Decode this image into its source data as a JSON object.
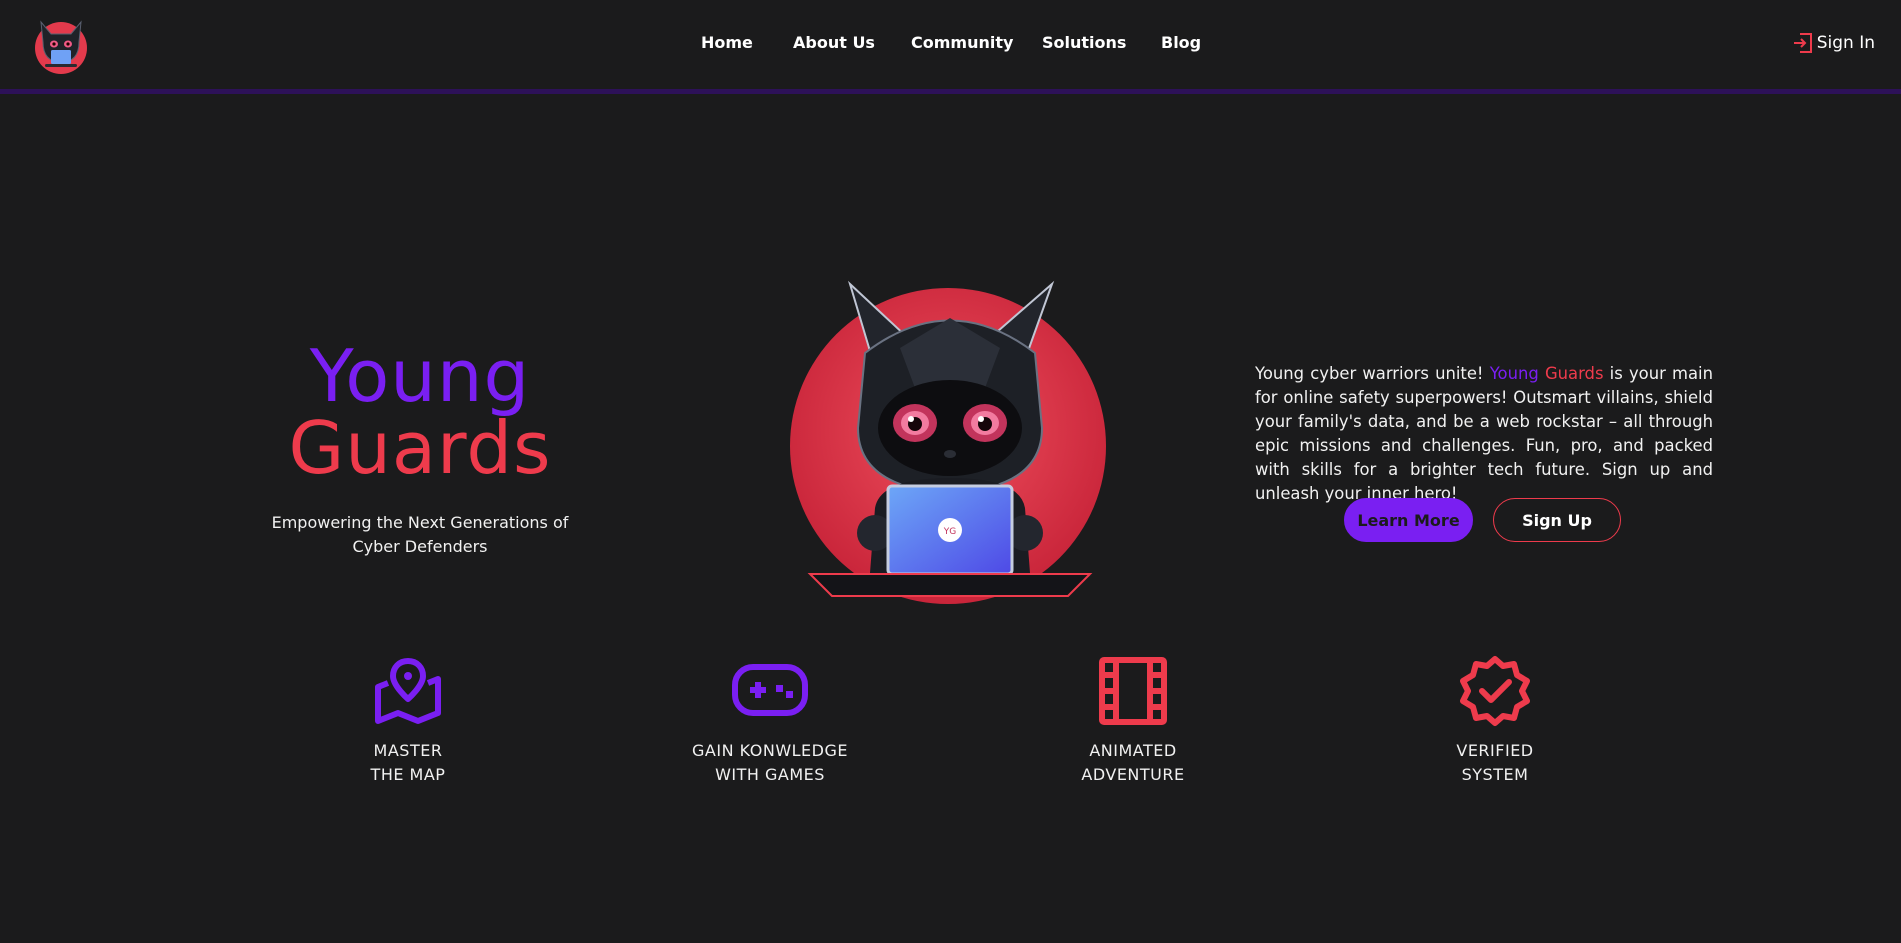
{
  "header": {
    "nav": [
      {
        "label": "Home"
      },
      {
        "label": "About Us"
      },
      {
        "label": "Community"
      },
      {
        "label": "Solutions"
      },
      {
        "label": "Blog"
      }
    ],
    "sign_in_label": "Sign In"
  },
  "hero": {
    "brand_line1": "Young",
    "brand_line2": "Guards",
    "tagline_line1": "Empowering the Next Generations of",
    "tagline_line2": "Cyber Defenders",
    "laptop_badge": "YG",
    "description_before": "Young cyber warriors unite! ",
    "description_brand_1": "Young",
    "description_brand_space": " ",
    "description_brand_2": "Guards",
    "description_after": " is your main for online safety superpowers! Outsmart villains, shield your family's data, and be a web rockstar – all through epic missions and challenges. Fun, pro, and packed with skills for a brighter tech future. Sign up and unleash your inner hero!",
    "learn_more_label": "Learn More",
    "sign_up_label": "Sign Up"
  },
  "features": [
    {
      "line1": "MASTER",
      "line2": "THE MAP",
      "icon": "map-pin-icon"
    },
    {
      "line1": "GAIN KONWLEDGE",
      "line2": "WITH GAMES",
      "icon": "gamepad-icon"
    },
    {
      "line1": "ANIMATED",
      "line2": "ADVENTURE",
      "icon": "film-icon"
    },
    {
      "line1": "VERIFIED",
      "line2": "SYSTEM",
      "icon": "verified-badge-icon"
    }
  ],
  "colors": {
    "background": "#1b1b1c",
    "purple": "#7a1ff2",
    "red": "#ee3b4c",
    "header_border": "#2d1158"
  }
}
